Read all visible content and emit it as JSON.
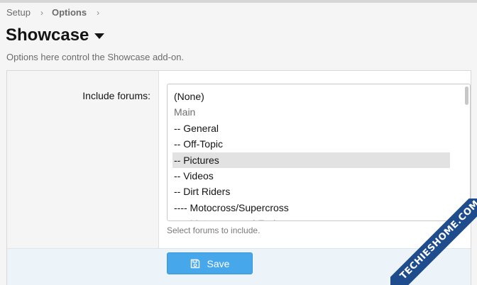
{
  "breadcrumb": {
    "items": [
      "Setup",
      "Options"
    ],
    "separator": "›"
  },
  "page": {
    "title": "Showcase",
    "description": "Options here control the Showcase add-on."
  },
  "form": {
    "label": "Include forums:",
    "help": "Select forums to include.",
    "options": [
      {
        "label": "(None)",
        "type": "option",
        "selected": false
      },
      {
        "label": "Main",
        "type": "group",
        "selected": false
      },
      {
        "label": "-- General",
        "type": "option",
        "selected": false
      },
      {
        "label": "-- Off-Topic",
        "type": "option",
        "selected": false
      },
      {
        "label": "-- Pictures",
        "type": "option",
        "selected": true
      },
      {
        "label": "-- Videos",
        "type": "option",
        "selected": false
      },
      {
        "label": "-- Dirt Riders",
        "type": "option",
        "selected": false
      },
      {
        "label": "---- Motocross/Supercross",
        "type": "option",
        "selected": false
      },
      {
        "label": "---- Motocross and Enduro",
        "type": "option",
        "selected": false
      }
    ]
  },
  "footer": {
    "save_label": "Save",
    "save_icon": "save-icon"
  },
  "watermark": {
    "text": "TECHIESHOME.COM"
  },
  "colors": {
    "accent": "#47a7eb",
    "selected_bg": "#e2e2e2",
    "watermark": "#1e4c8c"
  }
}
